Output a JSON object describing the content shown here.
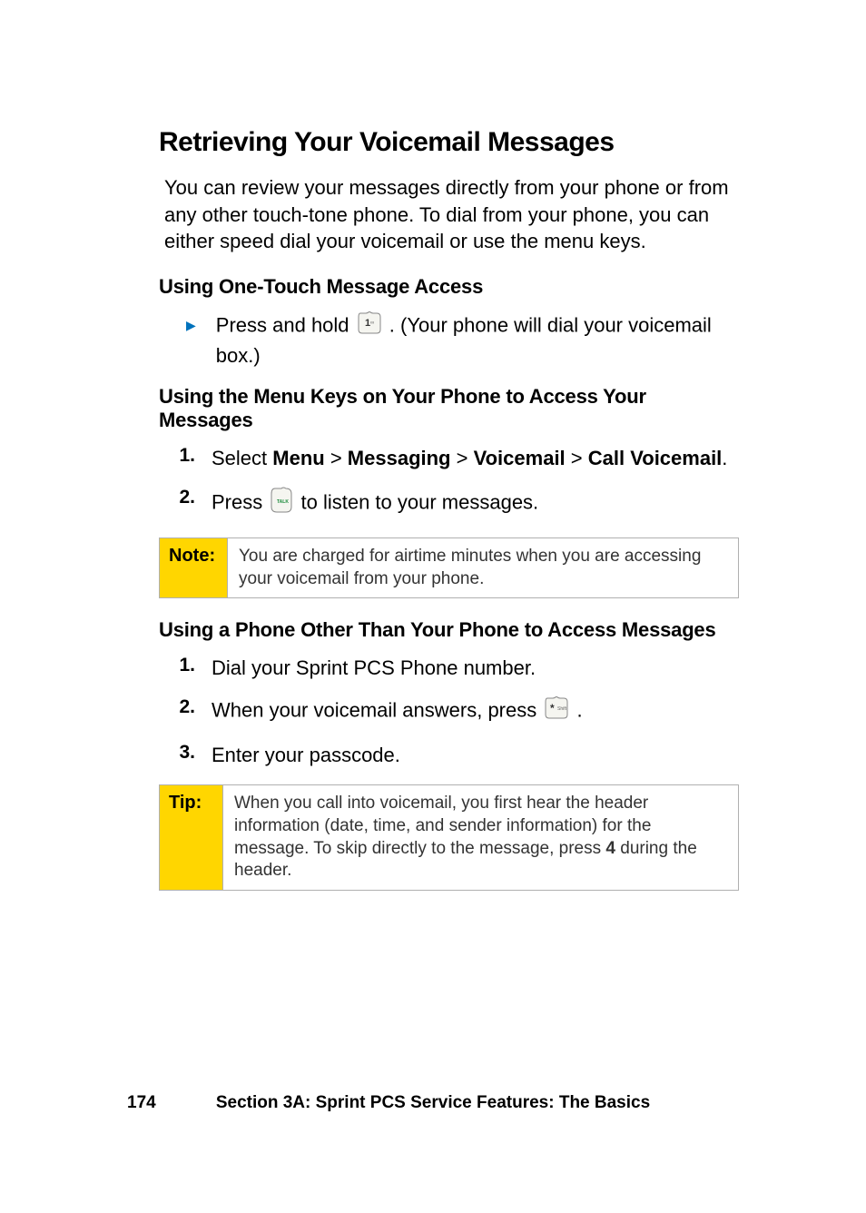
{
  "title": "Retrieving Your Voicemail Messages",
  "intro": "You can review your messages directly from your phone or from any other touch-tone phone. To dial from your phone, you can either speed dial your voicemail or use the menu keys.",
  "sub1": {
    "heading": "Using One-Touch Message Access",
    "bullet_pre": "Press and hold ",
    "bullet_post": ". (Your phone will dial your voicemail box.)"
  },
  "sub2": {
    "heading": "Using the Menu Keys on Your Phone to Access Your Messages",
    "step1_pre": "Select ",
    "step1_menu": "Menu",
    "step1_gt1": " > ",
    "step1_messaging": "Messaging",
    "step1_gt2": " > ",
    "step1_voicemail": "Voicemail",
    "step1_gt3": " > ",
    "step1_call": "Call Voicemail",
    "step1_end": ".",
    "step2_pre": "Press ",
    "step2_post": " to listen to your messages."
  },
  "note": {
    "label": "Note:",
    "text": "You are charged for airtime minutes when you are accessing your voicemail from your phone."
  },
  "sub3": {
    "heading": "Using a Phone Other Than Your Phone to Access Messages",
    "step1": "Dial your Sprint PCS Phone number.",
    "step2_pre": "When your voicemail answers, press ",
    "step2_post": ".",
    "step3": "Enter your passcode."
  },
  "tip": {
    "label": "Tip:",
    "text_pre": "When you call into voicemail, you first hear the header information (date, time, and sender information) for the message. To skip directly to the message, press ",
    "text_bold": "4",
    "text_post": " during the header."
  },
  "footer": {
    "page": "174",
    "title": "Section 3A: Sprint PCS Service Features: The Basics"
  },
  "step_numbers": {
    "n1": "1.",
    "n2": "2.",
    "n3": "3."
  }
}
